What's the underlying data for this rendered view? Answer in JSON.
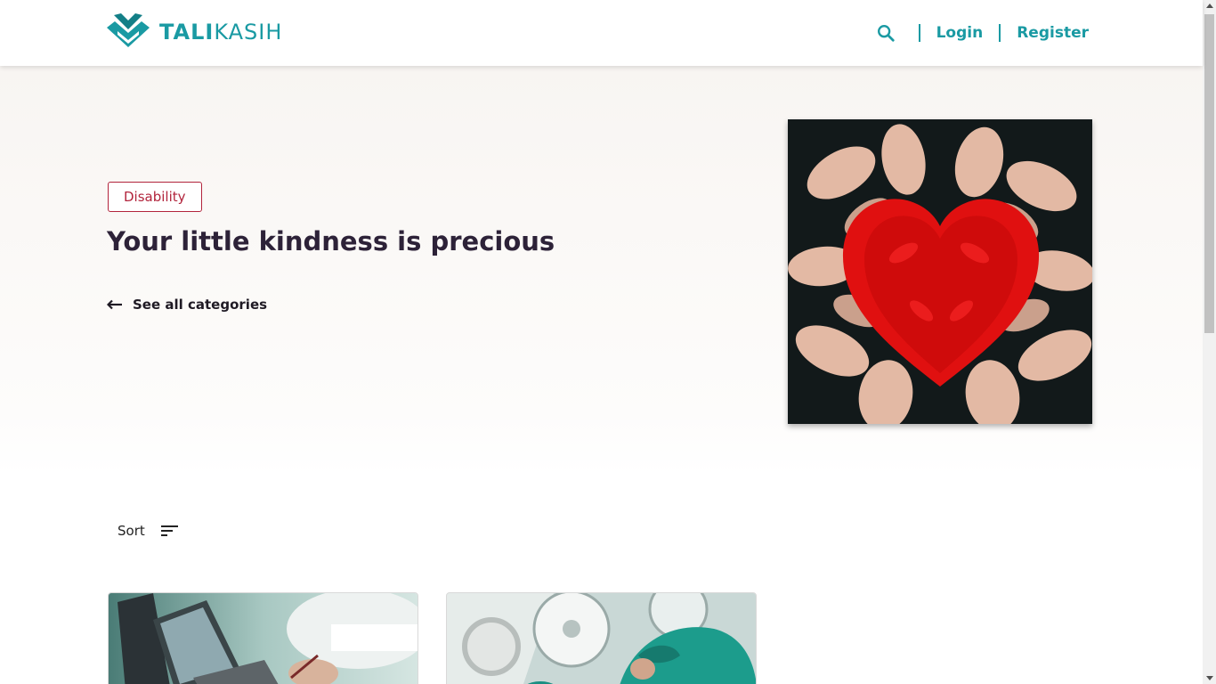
{
  "brand": {
    "name_bold": "TALI",
    "name_light": "KASIH",
    "color": "#1a9aa3",
    "icon": "talikasih-logo-icon"
  },
  "nav": {
    "search_icon": "search-icon",
    "login_label": "Login",
    "register_label": "Register"
  },
  "hero": {
    "category_label": "Disability",
    "title": "Your little kindness is precious",
    "see_all_label": "See all categories",
    "image_alt": "hands painted red forming a heart",
    "accent_color": "#b2243c"
  },
  "sort": {
    "label": "Sort",
    "icon": "sort-icon"
  },
  "cards": [
    {
      "image_alt": "person writing next to a laptop"
    },
    {
      "image_alt": "surgeons in an operating room"
    }
  ]
}
